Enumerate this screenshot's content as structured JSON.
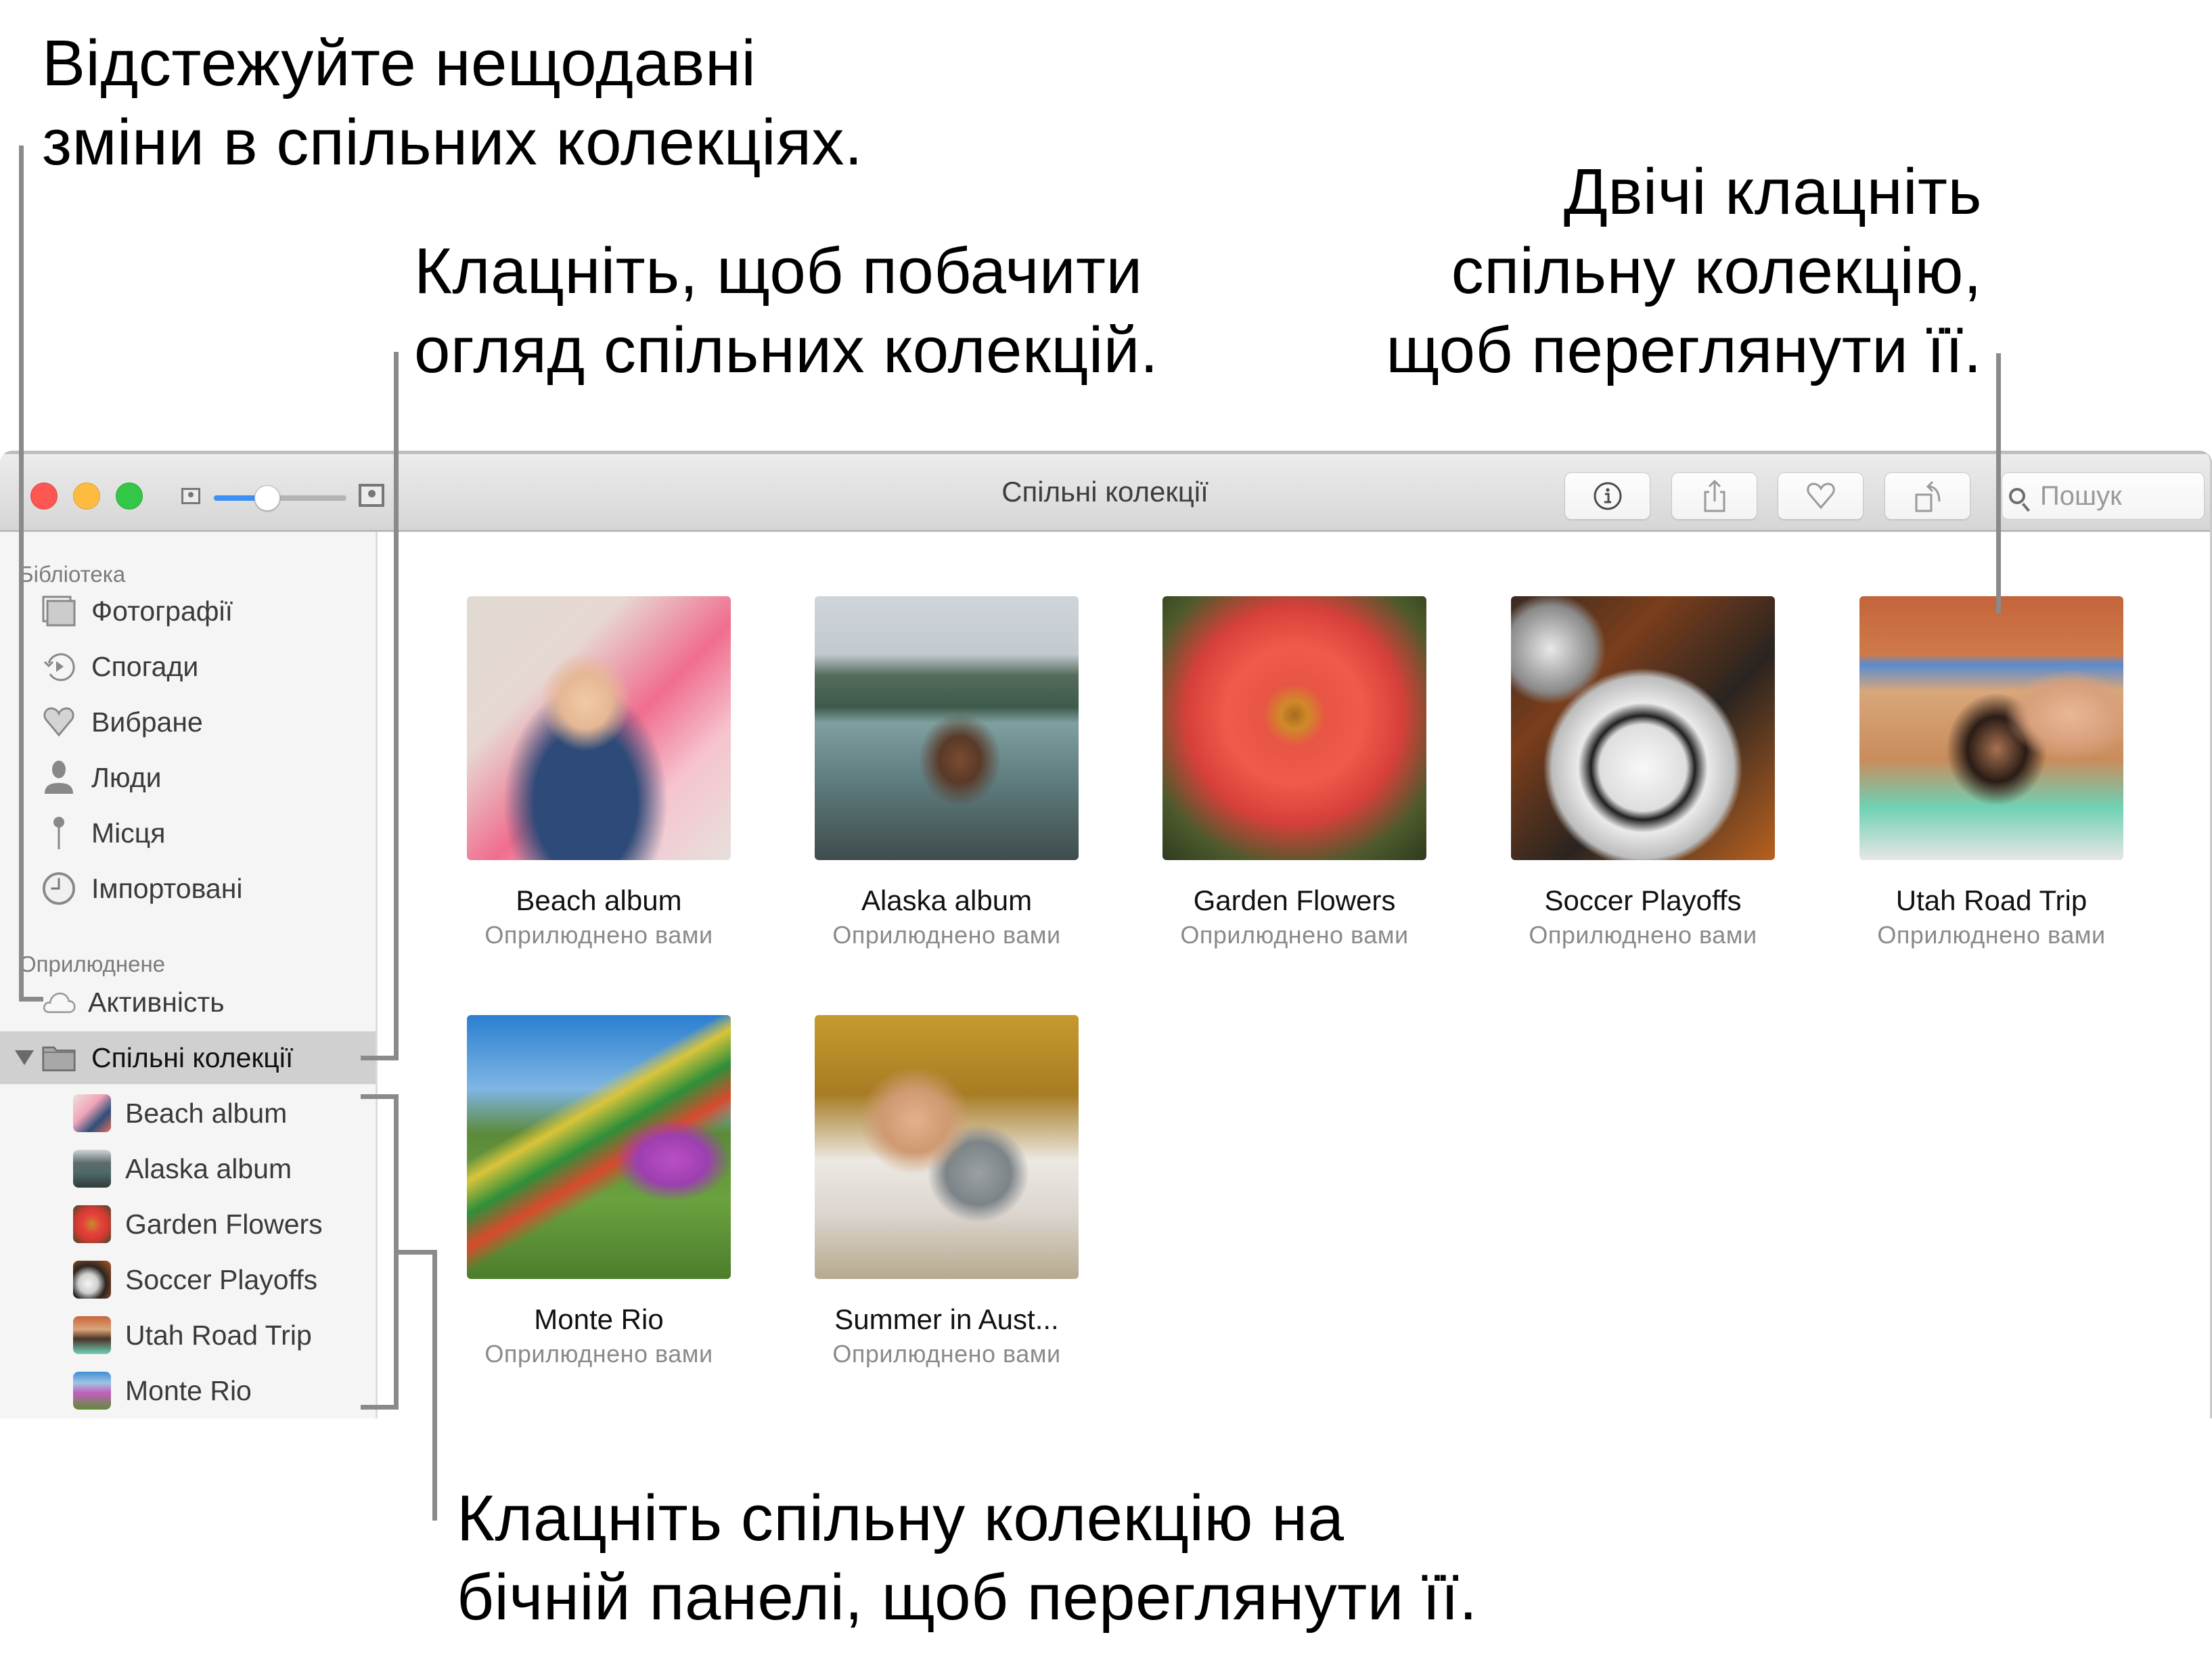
{
  "annotations": {
    "activity": [
      "Відстежуйте нещодавні",
      "зміни в спільних колекціях."
    ],
    "overview": [
      "Клацніть, щоб побачити",
      "огляд спільних колекцій."
    ],
    "double_click": [
      "Двічі клацніть",
      "спільну колекцію,",
      "щоб переглянути її."
    ],
    "sidebar_click": [
      "Клацніть спільну колекцію на",
      "бічній панелі, щоб переглянути її."
    ]
  },
  "window": {
    "title": "Спільні колекції",
    "zoom_slider_value": 0.4,
    "toolbar": {
      "info_icon": "info-icon",
      "share_icon": "share-icon",
      "favorite_icon": "heart-icon",
      "rotate_icon": "rotate-icon",
      "search_placeholder": "Пошук"
    }
  },
  "sidebar": {
    "library_heading": "Бібліотека",
    "library_items": [
      {
        "label": "Фотографії",
        "icon": "photos-icon"
      },
      {
        "label": "Спогади",
        "icon": "memories-icon"
      },
      {
        "label": "Вибране",
        "icon": "heart-icon"
      },
      {
        "label": "Люди",
        "icon": "person-icon"
      },
      {
        "label": "Місця",
        "icon": "pin-icon"
      },
      {
        "label": "Імпортовані",
        "icon": "clock-icon"
      }
    ],
    "shared_heading": "Оприлюднене",
    "activity": {
      "label": "Активність",
      "icon": "cloud-icon"
    },
    "shared_albums": {
      "label": "Спільні колекції",
      "icon": "folder-icon",
      "expanded": true,
      "selected": true
    },
    "albums": [
      {
        "label": "Beach album"
      },
      {
        "label": "Alaska album"
      },
      {
        "label": "Garden Flowers"
      },
      {
        "label": "Soccer Playoffs"
      },
      {
        "label": "Utah Road Trip"
      },
      {
        "label": "Monte Rio"
      }
    ]
  },
  "main": {
    "albums": [
      {
        "title": "Beach album",
        "subtitle": "Оприлюднено вами"
      },
      {
        "title": "Alaska album",
        "subtitle": "Оприлюднено вами"
      },
      {
        "title": "Garden Flowers",
        "subtitle": "Оприлюднено вами"
      },
      {
        "title": "Soccer Playoffs",
        "subtitle": "Оприлюднено вами"
      },
      {
        "title": "Utah Road Trip",
        "subtitle": "Оприлюднено вами"
      },
      {
        "title": "Monte Rio",
        "subtitle": "Оприлюднено вами"
      },
      {
        "title": "Summer in Aust...",
        "subtitle": "Оприлюднено вами"
      }
    ]
  },
  "colors": {
    "close": "#fc5753",
    "minimize": "#fdbc40",
    "zoom": "#33c748",
    "slider_accent": "#3b8ff7",
    "selection": "#d0d0d0",
    "sidebar_bg": "#f5f5f5",
    "callout_line": "#8a8a8a"
  }
}
